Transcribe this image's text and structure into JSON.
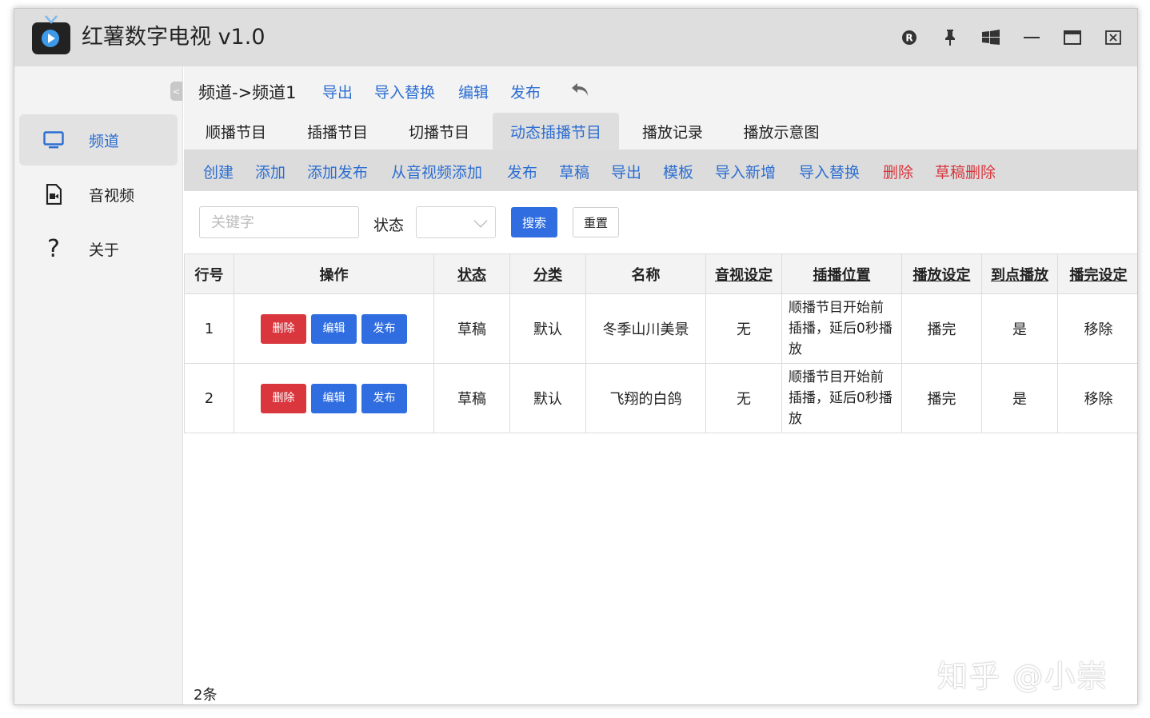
{
  "app": {
    "title": "红薯数字电视 v1.0"
  },
  "titlebar_icons": [
    "r-badge-icon",
    "pin-icon",
    "windows-icon",
    "minimize-icon",
    "maximize-icon",
    "close-icon"
  ],
  "sidebar": {
    "items": [
      {
        "label": "频道",
        "icon": "monitor-icon",
        "active": true
      },
      {
        "label": "音视频",
        "icon": "video-file-icon",
        "active": false
      },
      {
        "label": "关于",
        "icon": "question-icon",
        "active": false
      }
    ]
  },
  "breadcrumb": {
    "path": "频道->频道1",
    "actions": [
      "导出",
      "导入替换",
      "编辑",
      "发布"
    ]
  },
  "tabs": [
    {
      "label": "顺播节目",
      "active": false
    },
    {
      "label": "插播节目",
      "active": false
    },
    {
      "label": "切播节目",
      "active": false
    },
    {
      "label": "动态插播节目",
      "active": true
    },
    {
      "label": "播放记录",
      "active": false
    },
    {
      "label": "播放示意图",
      "active": false
    }
  ],
  "actions": [
    {
      "label": "创建",
      "danger": false
    },
    {
      "label": "添加",
      "danger": false
    },
    {
      "label": "添加发布",
      "danger": false
    },
    {
      "label": "从音视频添加",
      "danger": false
    },
    {
      "label": "发布",
      "danger": false
    },
    {
      "label": "草稿",
      "danger": false
    },
    {
      "label": "导出",
      "danger": false
    },
    {
      "label": "模板",
      "danger": false
    },
    {
      "label": "导入新增",
      "danger": false
    },
    {
      "label": "导入替换",
      "danger": false
    },
    {
      "label": "删除",
      "danger": true
    },
    {
      "label": "草稿删除",
      "danger": true
    }
  ],
  "search": {
    "keyword_placeholder": "关键字",
    "keyword_value": "",
    "status_label": "状态",
    "status_value": "",
    "search_button": "搜索",
    "reset_button": "重置"
  },
  "table": {
    "columns": [
      "行号",
      "操作",
      "状态",
      "分类",
      "名称",
      "音视设定",
      "插播位置",
      "播放设定",
      "到点播放",
      "播完设定"
    ],
    "row_buttons": {
      "delete": "删除",
      "edit": "编辑",
      "publish": "发布"
    },
    "rows": [
      {
        "index": "1",
        "status": "草稿",
        "category": "默认",
        "name": "冬季山川美景",
        "av_setting": "无",
        "position": "顺播节目开始前插播，延后0秒播放",
        "play_setting": "播完",
        "on_time": "是",
        "after_play": "移除"
      },
      {
        "index": "2",
        "status": "草稿",
        "category": "默认",
        "name": "飞翔的白鸽",
        "av_setting": "无",
        "position": "顺播节目开始前插播，延后0秒播放",
        "play_setting": "播完",
        "on_time": "是",
        "after_play": "移除"
      }
    ],
    "count_text": "2条"
  },
  "watermark": "知乎 @小崇",
  "colors": {
    "accent": "#2d6ed1",
    "primary_button": "#2f6de1",
    "danger": "#d9363e",
    "titlebar": "#dedede",
    "sidebar": "#f3f3f3"
  }
}
